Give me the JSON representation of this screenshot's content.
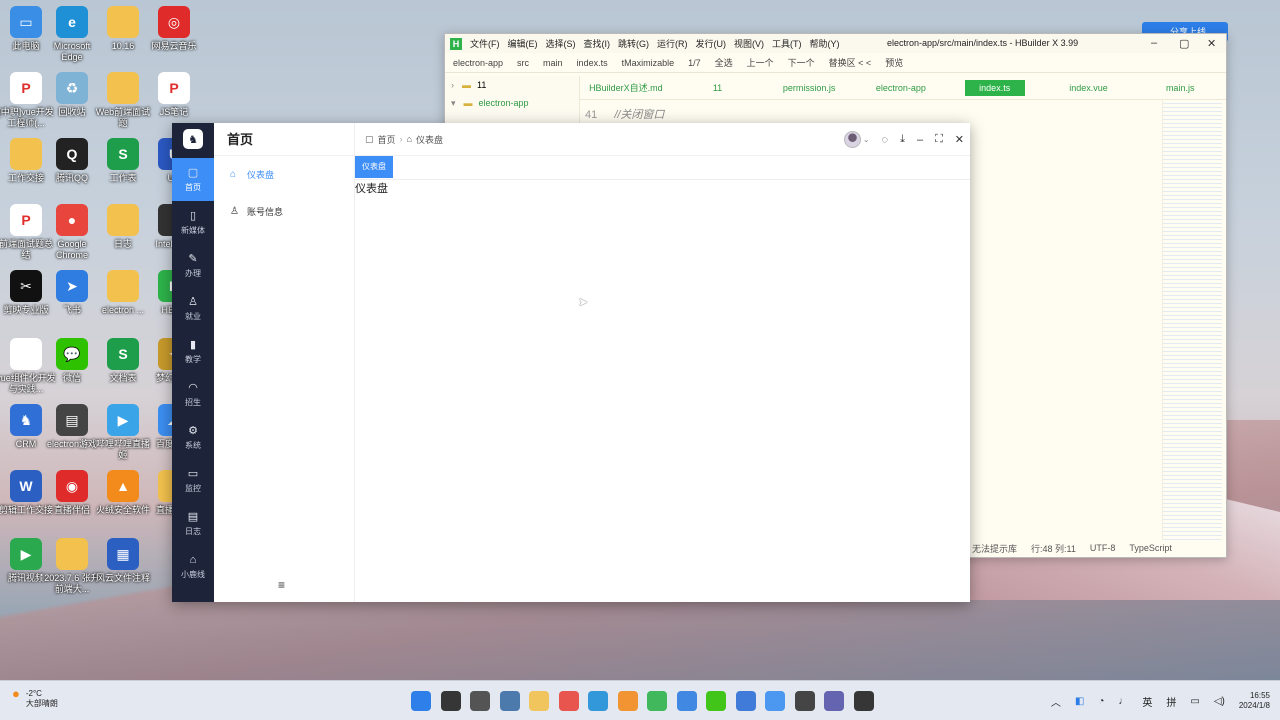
{
  "desktop_icons": [
    {
      "label": "此电脑",
      "color": "#3a8ee6",
      "glyph": "▭"
    },
    {
      "label": "Microsoft Edge",
      "color": "#1f8fd6",
      "glyph": "e"
    },
    {
      "label": "10.16",
      "color": "#f2c14e",
      "glyph": ""
    },
    {
      "label": "网易云音乐",
      "color": "#e02b2b",
      "glyph": "◎"
    },
    {
      "label": "[中职]vue开发工程师(...",
      "color": "#fff",
      "glyph": "P"
    },
    {
      "label": "回收站",
      "color": "#7fb3d5",
      "glyph": "♻"
    },
    {
      "label": "Web前端面试题",
      "color": "#f2c14e",
      "glyph": ""
    },
    {
      "label": "JS笔记",
      "color": "#fff",
      "glyph": "P"
    },
    {
      "label": "工作交接",
      "color": "#f2c14e",
      "glyph": ""
    },
    {
      "label": "腾讯QQ",
      "color": "#222",
      "glyph": "Q"
    },
    {
      "label": "工作表",
      "color": "#1e9e4a",
      "glyph": "S"
    },
    {
      "label": "UU",
      "color": "#2b59c3",
      "glyph": "U"
    },
    {
      "label": "前端面试题总结",
      "color": "#fff",
      "glyph": "P"
    },
    {
      "label": "Google Chrome",
      "color": "#e8453c",
      "glyph": "●"
    },
    {
      "label": "日志",
      "color": "#f2c14e",
      "glyph": ""
    },
    {
      "label": "Intel 20...",
      "color": "#333",
      "glyph": "i"
    },
    {
      "label": "剪映专业版",
      "color": "#111",
      "glyph": "✂"
    },
    {
      "label": "飞书",
      "color": "#2f7de1",
      "glyph": "➤"
    },
    {
      "label": "electron ...",
      "color": "#f2c14e",
      "glyph": ""
    },
    {
      "label": "HBu...",
      "color": "#2eb34a",
      "glyph": "H"
    },
    {
      "label": "vue组件化开发与实践...",
      "color": "#fff",
      "glyph": ""
    },
    {
      "label": "微信",
      "color": "#2dc100",
      "glyph": "💬"
    },
    {
      "label": "文档表",
      "color": "#1e9e4a",
      "glyph": "S"
    },
    {
      "label": "梦幻西游",
      "color": "#c79a2b",
      "glyph": "✦"
    },
    {
      "label": "CRM",
      "color": "#2f6fd6",
      "glyph": "♞"
    },
    {
      "label": "electron游戏",
      "color": "#444",
      "glyph": "▤"
    },
    {
      "label": "哔哩哔哩直播姬",
      "color": "#39a5e8",
      "glyph": "▶"
    },
    {
      "label": "百度网盘",
      "color": "#3b8ef0",
      "glyph": "☁"
    },
    {
      "label": "剪辑工作交接",
      "color": "#2b5fc1",
      "glyph": "W"
    },
    {
      "label": "直播伴侣",
      "color": "#e02b2b",
      "glyph": "◉"
    },
    {
      "label": "火绒安全软件",
      "color": "#f28b1c",
      "glyph": "▲"
    },
    {
      "label": "直播用图",
      "color": "#f2c14e",
      "glyph": ""
    },
    {
      "label": "腾讯视频",
      "color": "#2ba94f",
      "glyph": "▶"
    },
    {
      "label": "2023.7.6 张升 前端大...",
      "color": "#f2c14e",
      "glyph": ""
    },
    {
      "label": "风云文件注释",
      "color": "#2b5fc1",
      "glyph": "▦"
    }
  ],
  "hbuilder": {
    "logo": "H",
    "menu": [
      "文件(F)",
      "编辑(E)",
      "选择(S)",
      "查找(I)",
      "跳转(G)",
      "运行(R)",
      "发行(U)",
      "视图(V)",
      "工具(T)",
      "帮助(Y)"
    ],
    "title": "electron-app/src/main/index.ts - HBuilder X 3.99",
    "toolbar": [
      "electron-app",
      "src",
      "main",
      "index.ts",
      "tMaximizable",
      "1/7",
      "全选",
      "上一个",
      "下一个",
      "替换区 < <",
      "预览"
    ],
    "tree": [
      "11",
      "electron-app"
    ],
    "tabs": [
      "HBuilderX自述.md",
      "11",
      "permission.js",
      "electron-app",
      "index.ts",
      "index.vue",
      "main.js"
    ],
    "active_tab": "index.ts",
    "line_no": "41",
    "code": "//关闭窗口",
    "status": [
      "无法提示库",
      "行:48  列:11",
      "UTF-8",
      "TypeScript"
    ],
    "share_button": "分享上线"
  },
  "app": {
    "logo": "♞",
    "nav": [
      {
        "label": "首页",
        "icon": "▢",
        "active": true
      },
      {
        "label": "新媒体",
        "icon": "▯"
      },
      {
        "label": "办理",
        "icon": "✎"
      },
      {
        "label": "就业",
        "icon": "♙"
      },
      {
        "label": "教学",
        "icon": "▮"
      },
      {
        "label": "招生",
        "icon": "◠"
      },
      {
        "label": "系统",
        "icon": "⚙"
      },
      {
        "label": "监控",
        "icon": "▭"
      },
      {
        "label": "日志",
        "icon": "▤"
      },
      {
        "label": "小鹿线",
        "icon": "⌂"
      }
    ],
    "side_title": "首页",
    "menu": [
      {
        "label": "仪表盘",
        "icon": "⌂",
        "active": true
      },
      {
        "label": "账号信息",
        "icon": "♙"
      }
    ],
    "collapse_icon": "≡",
    "breadcrumb": [
      "首页",
      "仪表盘"
    ],
    "tag": "仪表盘",
    "content": "仪表盘"
  },
  "taskbar": {
    "weather_temp": "-2°C",
    "weather_desc": "大部晴朗",
    "ime": "英",
    "ime2": "拼",
    "time": "16:55",
    "date": "2024/1/8"
  }
}
